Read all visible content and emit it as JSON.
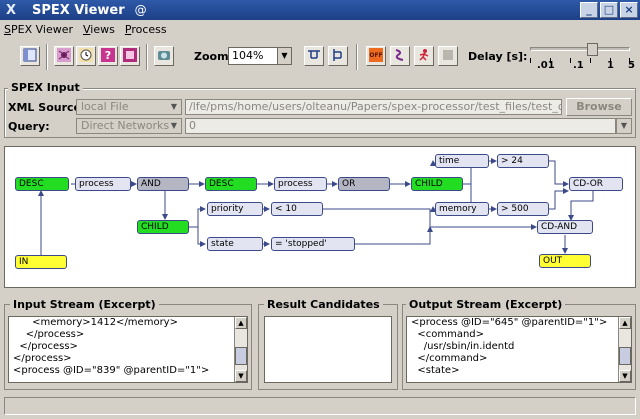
{
  "window": {
    "title": "SPEX Viewer",
    "icon_glyph": "X",
    "spiral_glyph": "@",
    "minimize_glyph": "_",
    "maximize_glyph": "□",
    "close_glyph": "×"
  },
  "menu": [
    "SPEX Viewer",
    "Views",
    "Process"
  ],
  "toolbar": {
    "zoom_label": "Zoom:",
    "zoom_value": "104%",
    "off_label": "OFF",
    "delay_label": "Delay [s]:",
    "slider_ticks": [
      ".01",
      ".1",
      "1",
      "5"
    ],
    "slider_value": 1
  },
  "spex_input": {
    "title": "SPEX Input",
    "xml_source_label": "XML Source:",
    "xml_source_value": "local File",
    "xml_path": "/lfe/pms/home/users/olteanu/Papers/spex-processor/test_files/test_data",
    "browse_label": "Browse",
    "query_label": "Query:",
    "query_type": "Direct Networks",
    "query_value": "0"
  },
  "graph": {
    "nodes": {
      "desc1": "DESC",
      "process1": "process",
      "and": "AND",
      "desc2": "DESC",
      "process2": "process",
      "or": "OR",
      "child1": "CHILD",
      "time": "time",
      "gt24": "> 24",
      "memory": "memory",
      "gt500": "> 500",
      "cdor": "CD-OR",
      "child2": "CHILD",
      "priority": "priority",
      "lt10": "< 10",
      "state": "state",
      "stopped": "= 'stopped'",
      "cdand": "CD-AND",
      "in": "IN",
      "out": "OUT"
    }
  },
  "panes": {
    "input": {
      "title": "Input Stream (Excerpt)",
      "lines": [
        "      <memory>1412</memory>",
        "    </process>",
        "  </process>",
        "</process>",
        "<process @ID=\"839\" @parentID=\"1\">"
      ]
    },
    "results": {
      "title": "Result Candidates"
    },
    "output": {
      "title": "Output Stream (Excerpt)",
      "lines": [
        "<process @ID=\"645\" @parentID=\"1\">",
        "  <command>",
        "    /usr/sbin/in.identd",
        "  </command>",
        "  <state>"
      ]
    }
  },
  "colors": {
    "title_bar": "#1d3f86",
    "node_green": "#22dd22",
    "node_yellow": "#ffff33",
    "node_light": "#e2e4f2",
    "node_gray": "#b4b6c4",
    "edge": "#3c4a8a"
  }
}
